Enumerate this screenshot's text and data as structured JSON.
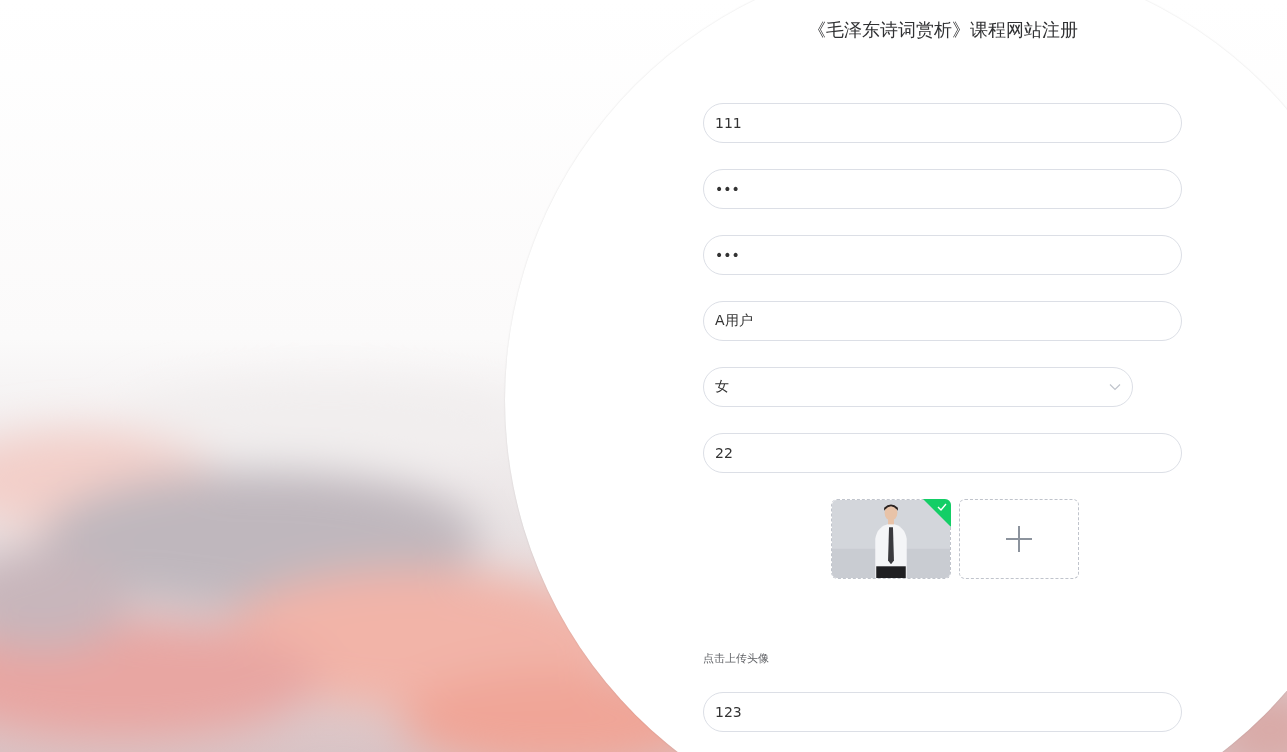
{
  "title": "《毛泽东诗词赏析》课程网站注册",
  "fields": [
    {
      "kind": "text",
      "value": "111"
    },
    {
      "kind": "password",
      "value": "•••"
    },
    {
      "kind": "password",
      "value": "•••"
    },
    {
      "kind": "text",
      "value": "A用户"
    },
    {
      "kind": "select",
      "value": "女"
    },
    {
      "kind": "text",
      "value": "22"
    },
    {
      "kind": "upload",
      "files": [
        {
          "kind": "picture",
          "success": true
        }
      ]
    },
    {
      "kind": "hint",
      "text": "点击上传头像"
    },
    {
      "kind": "text",
      "value": "123"
    }
  ]
}
